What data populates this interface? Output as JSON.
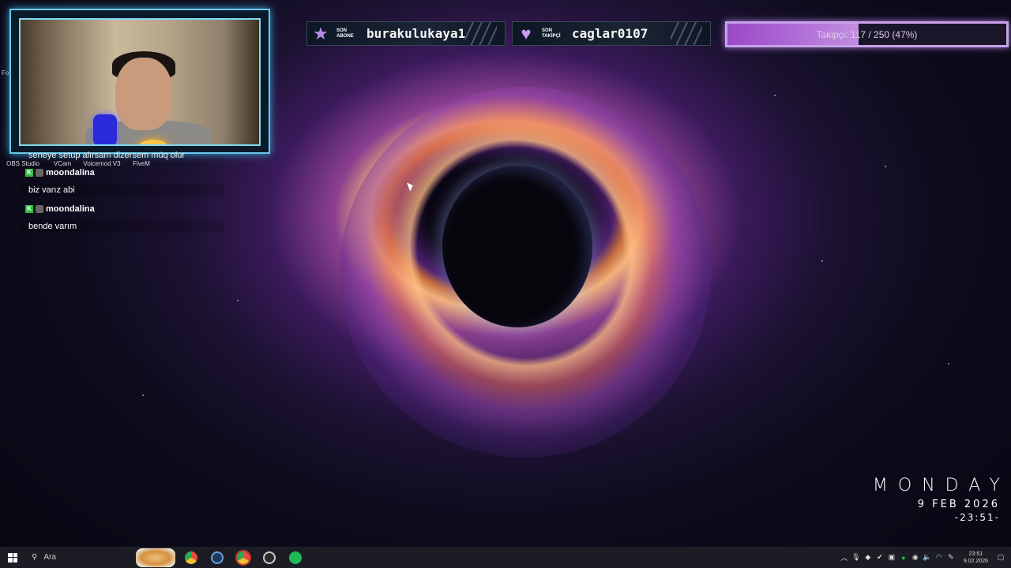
{
  "webcam": {
    "desktop_label_partial": "Fot",
    "desktop_icons": [
      "OBS Studio",
      "VCam",
      "Voicemod V3",
      "FiveM"
    ]
  },
  "chat": {
    "partial_message": "seneye setup alırsam dizersem müq olur",
    "messages": [
      {
        "user": "moondalina",
        "text": "biz varız abi"
      },
      {
        "user": "moondalina",
        "text": "bende varım"
      }
    ]
  },
  "panels": {
    "sub": {
      "label_top": "SON",
      "label_bottom": "ABONE",
      "name": "burakulukaya1",
      "icon": "star-icon",
      "icon_color": "#b48ae8"
    },
    "follow": {
      "label_top": "SON",
      "label_bottom": "TAKİPÇİ",
      "name": "caglar0107",
      "icon": "heart-icon",
      "icon_color": "#c89af0"
    }
  },
  "follower_goal": {
    "text": "Takipçi: 117 / 250 (47%)",
    "fraction": 0.47
  },
  "clock_widget": {
    "day": "MONDAY",
    "date": "9 FEB 2026",
    "time": "-23:51-"
  },
  "taskbar": {
    "search_placeholder": "Ara",
    "apps": [
      {
        "name": "chrome-icon",
        "color": "#e8b030"
      },
      {
        "name": "steam-icon",
        "color": "#2a75bb"
      },
      {
        "name": "chrome-profile-icon",
        "color": "#e84c3d"
      },
      {
        "name": "recorder-icon",
        "color": "#d0d0d0"
      },
      {
        "name": "spotify-icon",
        "color": "#1db954"
      }
    ],
    "clock_time": "23:51",
    "clock_date": "9.02.2026"
  }
}
